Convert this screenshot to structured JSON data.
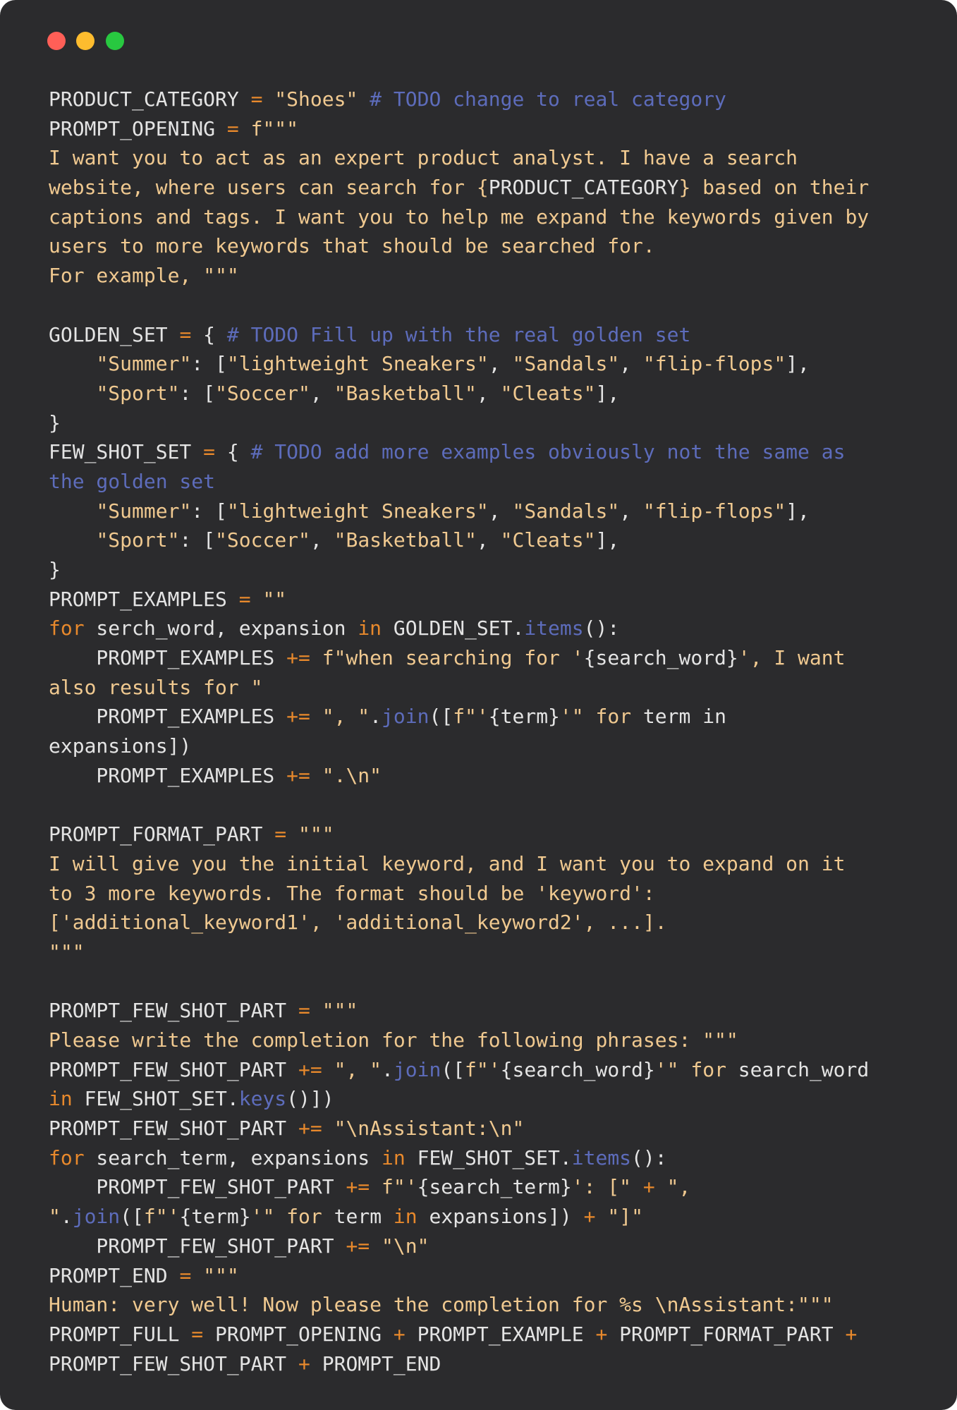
{
  "window": {
    "controls": [
      {
        "name": "close",
        "color": "#ff5f57"
      },
      {
        "name": "minimize",
        "color": "#febc2e"
      },
      {
        "name": "maximize",
        "color": "#28c840"
      }
    ],
    "background": "#2b2b2d"
  },
  "theme": {
    "plain": "#e4e4e4",
    "string": "#f0c990",
    "operator": "#e8892c",
    "comment": "#5d6cbb",
    "function": "#5d6cbb"
  },
  "code_lines": [
    [
      [
        "plain",
        "PRODUCT_CATEGORY "
      ],
      [
        "op",
        "="
      ],
      [
        "plain",
        " "
      ],
      [
        "str",
        "\"Shoes\""
      ],
      [
        "plain",
        " "
      ],
      [
        "cmt",
        "# TODO change to real category"
      ]
    ],
    [
      [
        "plain",
        "PROMPT_OPENING "
      ],
      [
        "op",
        "="
      ],
      [
        "plain",
        " "
      ],
      [
        "str",
        "f\"\"\""
      ]
    ],
    [
      [
        "str",
        "I want you to act as an expert product analyst. I have a search"
      ]
    ],
    [
      [
        "str",
        "website, where users can search for "
      ],
      [
        "str",
        "{"
      ],
      [
        "plain",
        "PRODUCT_CATEGORY"
      ],
      [
        "str",
        "}"
      ],
      [
        "str",
        " based on their"
      ]
    ],
    [
      [
        "str",
        "captions and tags. I want you to help me expand the keywords given by"
      ]
    ],
    [
      [
        "str",
        "users to more keywords that should be searched for."
      ]
    ],
    [
      [
        "str",
        "For example, \"\"\""
      ]
    ],
    [],
    [
      [
        "plain",
        "GOLDEN_SET "
      ],
      [
        "op",
        "="
      ],
      [
        "plain",
        " { "
      ],
      [
        "cmt",
        "# TODO Fill up with the real golden set"
      ]
    ],
    [
      [
        "plain",
        "    "
      ],
      [
        "str",
        "\"Summer\""
      ],
      [
        "plain",
        ": ["
      ],
      [
        "str",
        "\"lightweight Sneakers\""
      ],
      [
        "plain",
        ", "
      ],
      [
        "str",
        "\"Sandals\""
      ],
      [
        "plain",
        ", "
      ],
      [
        "str",
        "\"flip-flops\""
      ],
      [
        "plain",
        "],"
      ]
    ],
    [
      [
        "plain",
        "    "
      ],
      [
        "str",
        "\"Sport\""
      ],
      [
        "plain",
        ": ["
      ],
      [
        "str",
        "\"Soccer\""
      ],
      [
        "plain",
        ", "
      ],
      [
        "str",
        "\"Basketball\""
      ],
      [
        "plain",
        ", "
      ],
      [
        "str",
        "\"Cleats\""
      ],
      [
        "plain",
        "],"
      ]
    ],
    [
      [
        "plain",
        "}"
      ]
    ],
    [
      [
        "plain",
        "FEW_SHOT_SET "
      ],
      [
        "op",
        "="
      ],
      [
        "plain",
        " { "
      ],
      [
        "cmt",
        "# TODO add more examples obviously not the same as"
      ]
    ],
    [
      [
        "cmt",
        "the golden set"
      ]
    ],
    [
      [
        "plain",
        "    "
      ],
      [
        "str",
        "\"Summer\""
      ],
      [
        "plain",
        ": ["
      ],
      [
        "str",
        "\"lightweight Sneakers\""
      ],
      [
        "plain",
        ", "
      ],
      [
        "str",
        "\"Sandals\""
      ],
      [
        "plain",
        ", "
      ],
      [
        "str",
        "\"flip-flops\""
      ],
      [
        "plain",
        "],"
      ]
    ],
    [
      [
        "plain",
        "    "
      ],
      [
        "str",
        "\"Sport\""
      ],
      [
        "plain",
        ": ["
      ],
      [
        "str",
        "\"Soccer\""
      ],
      [
        "plain",
        ", "
      ],
      [
        "str",
        "\"Basketball\""
      ],
      [
        "plain",
        ", "
      ],
      [
        "str",
        "\"Cleats\""
      ],
      [
        "plain",
        "],"
      ]
    ],
    [
      [
        "plain",
        "}"
      ]
    ],
    [
      [
        "plain",
        "PROMPT_EXAMPLES "
      ],
      [
        "op",
        "="
      ],
      [
        "plain",
        " "
      ],
      [
        "str",
        "\"\""
      ]
    ],
    [
      [
        "kw",
        "for"
      ],
      [
        "plain",
        " serch_word, expansion "
      ],
      [
        "kw",
        "in"
      ],
      [
        "plain",
        " GOLDEN_SET."
      ],
      [
        "fn",
        "items"
      ],
      [
        "plain",
        "():"
      ]
    ],
    [
      [
        "plain",
        "    PROMPT_EXAMPLES "
      ],
      [
        "op",
        "+="
      ],
      [
        "plain",
        " "
      ],
      [
        "str",
        "f\"when searching for '"
      ],
      [
        "plain",
        "{search_word}"
      ],
      [
        "str",
        "', I want"
      ]
    ],
    [
      [
        "str",
        "also results for \""
      ]
    ],
    [
      [
        "plain",
        "    PROMPT_EXAMPLES "
      ],
      [
        "op",
        "+="
      ],
      [
        "plain",
        " "
      ],
      [
        "str",
        "\", \""
      ],
      [
        "plain",
        "."
      ],
      [
        "fn",
        "join"
      ],
      [
        "plain",
        "(["
      ],
      [
        "str",
        "f\"'"
      ],
      [
        "plain",
        "{term}"
      ],
      [
        "str",
        "'\" for"
      ],
      [
        "plain",
        " term in"
      ]
    ],
    [
      [
        "plain",
        "expansions])"
      ]
    ],
    [
      [
        "plain",
        "    PROMPT_EXAMPLES "
      ],
      [
        "op",
        "+="
      ],
      [
        "plain",
        " "
      ],
      [
        "str",
        "\".\\n\""
      ]
    ],
    [],
    [
      [
        "plain",
        "PROMPT_FORMAT_PART "
      ],
      [
        "op",
        "="
      ],
      [
        "plain",
        " "
      ],
      [
        "str",
        "\"\"\""
      ]
    ],
    [
      [
        "str",
        "I will give you the initial keyword, and I want you to expand on it"
      ]
    ],
    [
      [
        "str",
        "to 3 more keywords. The format should be 'keyword':"
      ]
    ],
    [
      [
        "str",
        "['additional_keyword1', 'additional_keyword2', ...]."
      ]
    ],
    [
      [
        "str",
        "\"\"\""
      ]
    ],
    [],
    [
      [
        "plain",
        "PROMPT_FEW_SHOT_PART "
      ],
      [
        "op",
        "="
      ],
      [
        "plain",
        " "
      ],
      [
        "str",
        "\"\"\""
      ]
    ],
    [
      [
        "str",
        "Please write the completion for the following phrases: \"\"\""
      ]
    ],
    [
      [
        "plain",
        "PROMPT_FEW_SHOT_PART "
      ],
      [
        "op",
        "+="
      ],
      [
        "plain",
        " "
      ],
      [
        "str",
        "\", \""
      ],
      [
        "plain",
        "."
      ],
      [
        "fn",
        "join"
      ],
      [
        "plain",
        "(["
      ],
      [
        "str",
        "f\"'"
      ],
      [
        "plain",
        "{search_word}"
      ],
      [
        "str",
        "'\" for"
      ],
      [
        "plain",
        " search_word"
      ]
    ],
    [
      [
        "kw",
        "in"
      ],
      [
        "plain",
        " FEW_SHOT_SET."
      ],
      [
        "fn",
        "keys"
      ],
      [
        "plain",
        "()])"
      ]
    ],
    [
      [
        "plain",
        "PROMPT_FEW_SHOT_PART "
      ],
      [
        "op",
        "+="
      ],
      [
        "plain",
        " "
      ],
      [
        "str",
        "\"\\nAssistant:\\n\""
      ]
    ],
    [
      [
        "kw",
        "for"
      ],
      [
        "plain",
        " search_term, expansions "
      ],
      [
        "kw",
        "in"
      ],
      [
        "plain",
        " FEW_SHOT_SET."
      ],
      [
        "fn",
        "items"
      ],
      [
        "plain",
        "():"
      ]
    ],
    [
      [
        "plain",
        "    PROMPT_FEW_SHOT_PART "
      ],
      [
        "op",
        "+="
      ],
      [
        "plain",
        " "
      ],
      [
        "str",
        "f\"'"
      ],
      [
        "plain",
        "{search_term}"
      ],
      [
        "str",
        "': [\""
      ],
      [
        "plain",
        " "
      ],
      [
        "op",
        "+"
      ],
      [
        "plain",
        " "
      ],
      [
        "str",
        "\","
      ]
    ],
    [
      [
        "str",
        "\""
      ],
      [
        "plain",
        "."
      ],
      [
        "fn",
        "join"
      ],
      [
        "plain",
        "(["
      ],
      [
        "str",
        "f\"'"
      ],
      [
        "plain",
        "{term}"
      ],
      [
        "str",
        "'\" for"
      ],
      [
        "plain",
        " term "
      ],
      [
        "kw",
        "in"
      ],
      [
        "plain",
        " expansions]) "
      ],
      [
        "op",
        "+"
      ],
      [
        "plain",
        " "
      ],
      [
        "str",
        "\"]\""
      ]
    ],
    [
      [
        "plain",
        "    PROMPT_FEW_SHOT_PART "
      ],
      [
        "op",
        "+="
      ],
      [
        "plain",
        " "
      ],
      [
        "str",
        "\"\\n\""
      ]
    ],
    [
      [
        "plain",
        "PROMPT_END "
      ],
      [
        "op",
        "="
      ],
      [
        "plain",
        " "
      ],
      [
        "str",
        "\"\"\""
      ]
    ],
    [
      [
        "str",
        "Human: very well! Now please the completion for %s \\nAssistant:\"\"\""
      ]
    ],
    [
      [
        "plain",
        "PROMPT_FULL "
      ],
      [
        "op",
        "="
      ],
      [
        "plain",
        " PROMPT_OPENING "
      ],
      [
        "op",
        "+"
      ],
      [
        "plain",
        " PROMPT_EXAMPLE "
      ],
      [
        "op",
        "+"
      ],
      [
        "plain",
        " PROMPT_FORMAT_PART "
      ],
      [
        "op",
        "+"
      ]
    ],
    [
      [
        "plain",
        "PROMPT_FEW_SHOT_PART "
      ],
      [
        "op",
        "+"
      ],
      [
        "plain",
        " PROMPT_END"
      ]
    ]
  ]
}
